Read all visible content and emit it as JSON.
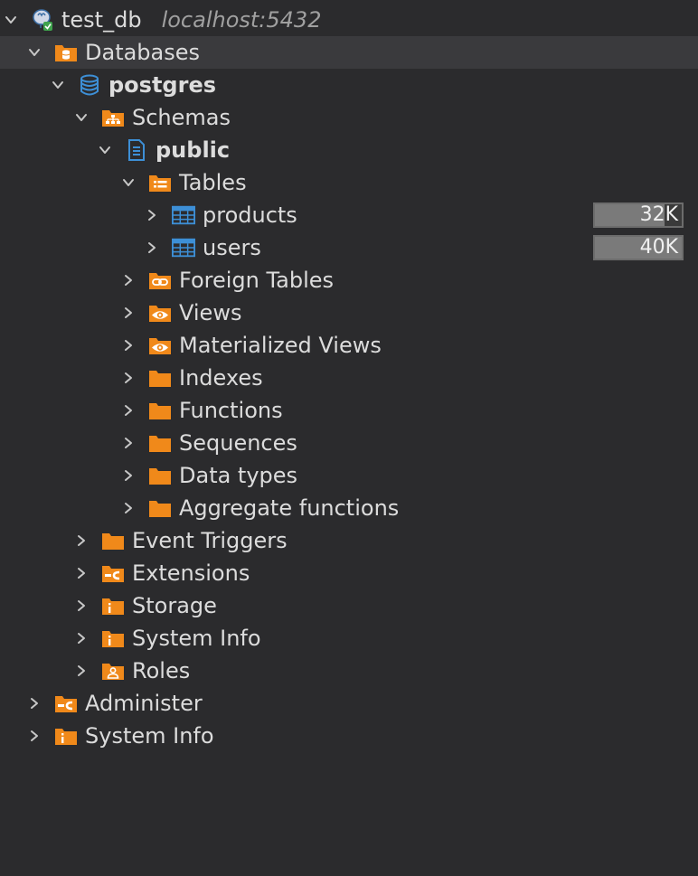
{
  "colors": {
    "background": "#2b2b2d",
    "selected_row": "#3a3a3d",
    "folder_orange": "#f0891a",
    "table_blue": "#3d8fd6",
    "text": "#dcdcdc",
    "muted_text": "#a0a0a0"
  },
  "rows": [
    {
      "label": "test_db",
      "subtitle": "localhost:5432",
      "expanded": true,
      "icon": "postgresql-connection-icon",
      "depth": 0
    },
    {
      "label": "Databases",
      "expanded": true,
      "icon": "databases-folder-icon",
      "depth": 1,
      "selected": true
    },
    {
      "label": "postgres",
      "expanded": true,
      "icon": "database-icon",
      "depth": 2,
      "bold": true
    },
    {
      "label": "Schemas",
      "expanded": true,
      "icon": "schemas-folder-icon",
      "depth": 3
    },
    {
      "label": "public",
      "expanded": true,
      "icon": "schema-icon",
      "depth": 4,
      "bold": true
    },
    {
      "label": "Tables",
      "expanded": true,
      "icon": "tables-folder-icon",
      "depth": 5
    },
    {
      "label": "products",
      "expanded": false,
      "icon": "table-icon",
      "depth": 6,
      "size": "32K",
      "size_fraction": 0.8
    },
    {
      "label": "users",
      "expanded": false,
      "icon": "table-icon",
      "depth": 6,
      "size": "40K",
      "size_fraction": 1.0
    },
    {
      "label": "Foreign Tables",
      "expanded": false,
      "icon": "foreign-tables-folder-icon",
      "depth": 5
    },
    {
      "label": "Views",
      "expanded": false,
      "icon": "views-folder-icon",
      "depth": 5
    },
    {
      "label": "Materialized Views",
      "expanded": false,
      "icon": "materialized-views-folder-icon",
      "depth": 5
    },
    {
      "label": "Indexes",
      "expanded": false,
      "icon": "folder-icon",
      "depth": 5
    },
    {
      "label": "Functions",
      "expanded": false,
      "icon": "folder-icon",
      "depth": 5
    },
    {
      "label": "Sequences",
      "expanded": false,
      "icon": "folder-icon",
      "depth": 5
    },
    {
      "label": "Data types",
      "expanded": false,
      "icon": "folder-icon",
      "depth": 5
    },
    {
      "label": "Aggregate functions",
      "expanded": false,
      "icon": "folder-icon",
      "depth": 5
    },
    {
      "label": "Event Triggers",
      "expanded": false,
      "icon": "folder-icon",
      "depth": 3
    },
    {
      "label": "Extensions",
      "expanded": false,
      "icon": "extensions-folder-icon",
      "depth": 3
    },
    {
      "label": "Storage",
      "expanded": false,
      "icon": "info-folder-icon",
      "depth": 3
    },
    {
      "label": "System Info",
      "expanded": false,
      "icon": "info-folder-icon",
      "depth": 3
    },
    {
      "label": "Roles",
      "expanded": false,
      "icon": "roles-folder-icon",
      "depth": 3
    },
    {
      "label": "Administer",
      "expanded": false,
      "icon": "administer-folder-icon",
      "depth": 1
    },
    {
      "label": "System Info",
      "expanded": false,
      "icon": "info-folder-icon",
      "depth": 1
    }
  ]
}
